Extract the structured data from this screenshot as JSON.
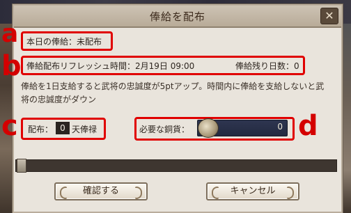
{
  "dialog": {
    "title": "俸給を配布",
    "close_label": "✕"
  },
  "status": {
    "today_label": "本日の俸給：",
    "today_value": "未配布"
  },
  "refresh": {
    "time_label": "俸給配布リフレッシュ時間：",
    "time_value": "2月19日 09:00",
    "days_left_label": "俸給残り日数：",
    "days_left_value": "0"
  },
  "description": "俸給を1日支給すると武将の忠誠度が5ptアップ。時間内に俸給を支給しないと武将の忠誠度がダウン",
  "distribute": {
    "label": "配布：",
    "value": "0",
    "unit": "天俸禄"
  },
  "coins": {
    "label": "必要な銅貨：",
    "value": "0",
    "icon": "copper-coin-icon"
  },
  "progress": {
    "fraction": 0
  },
  "buttons": {
    "confirm": "確認する",
    "cancel": "キャンセル"
  },
  "annotations": {
    "a": "a",
    "b": "b",
    "c": "c",
    "d": "d",
    "color": "#e00000"
  }
}
